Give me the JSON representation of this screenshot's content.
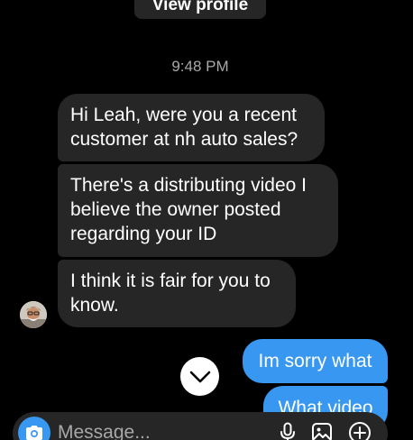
{
  "header": {
    "view_profile_label": "View profile"
  },
  "thread": {
    "timestamp": "9:48 PM",
    "incoming": [
      {
        "lines": [
          "Hi Leah, were you a recent",
          "customer at  nh auto sales?"
        ]
      },
      {
        "lines": [
          "There's a distributing video I",
          "believe the owner posted",
          "regarding your ID"
        ]
      },
      {
        "lines": [
          "I think it is fair for you to",
          "know."
        ]
      }
    ],
    "outgoing": [
      {
        "text": "Im sorry what"
      },
      {
        "text": "What video"
      }
    ]
  },
  "composer": {
    "placeholder": "Message...",
    "value": ""
  },
  "icons": {
    "avatar": "avatar",
    "scroll_down": "chevron-down-icon",
    "camera": "camera-icon",
    "mic": "microphone-icon",
    "gallery": "image-icon",
    "add": "plus-circle-icon"
  },
  "colors": {
    "background": "#000000",
    "incoming_bubble": "#262626",
    "outgoing_bubble": "#3897f0",
    "timestamp_text": "#a8a8a8",
    "text": "#ffffff"
  }
}
